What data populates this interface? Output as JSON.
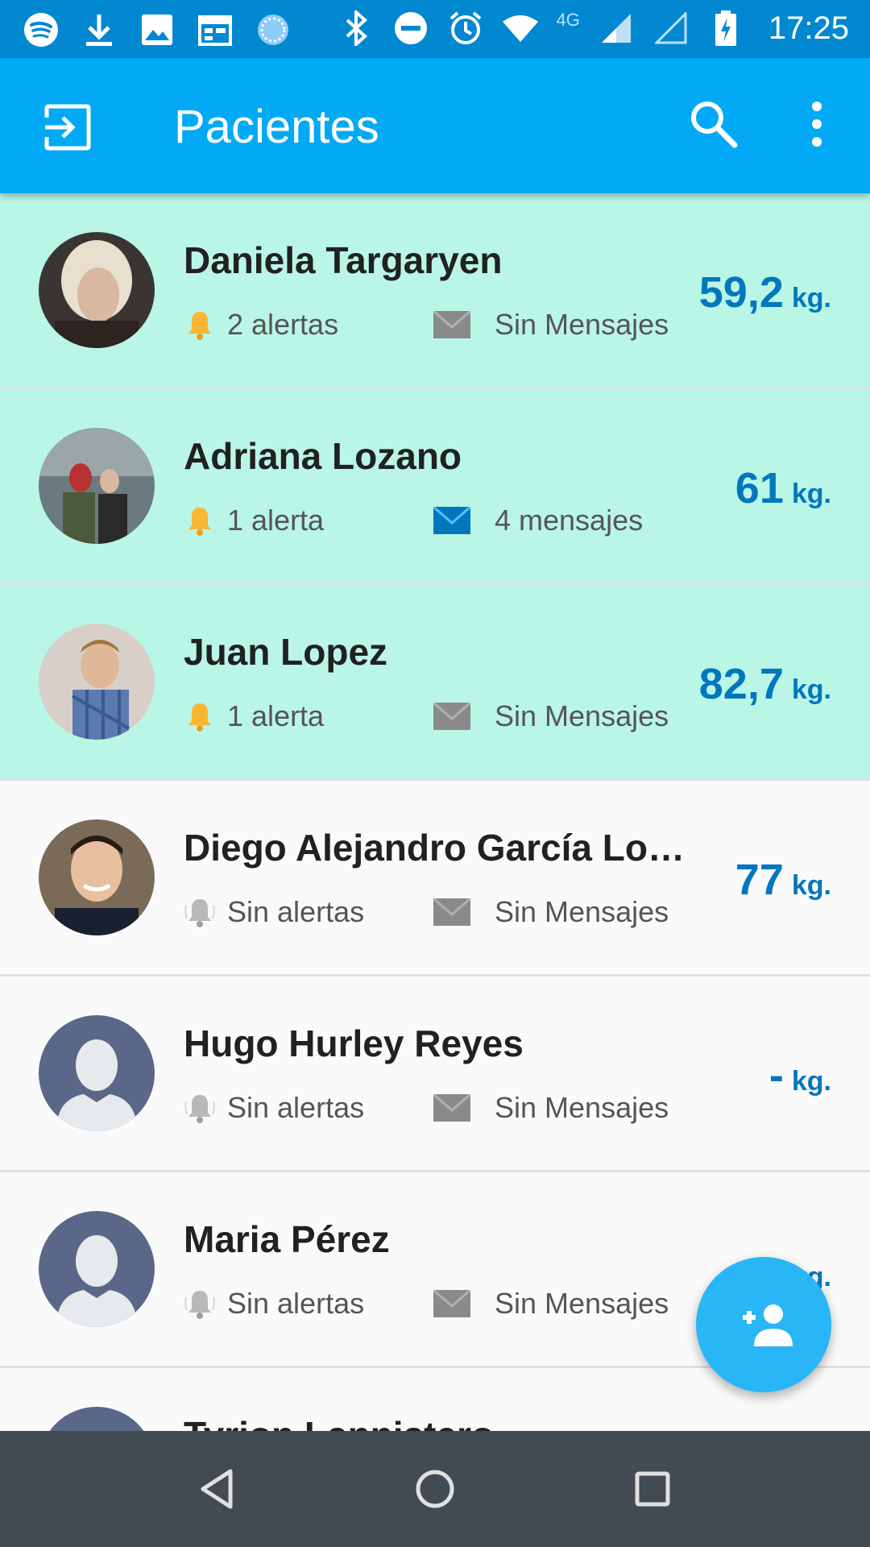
{
  "status_bar": {
    "time": "17:25",
    "network": "4G",
    "left_icons": [
      "spotify-icon",
      "download-icon",
      "image-icon",
      "calendar-icon",
      "sync-icon"
    ],
    "right_icons": [
      "bluetooth-icon",
      "dnd-icon",
      "alarm-icon",
      "wifi-icon",
      "signal-icon",
      "signal-empty-icon",
      "battery-charging-icon"
    ]
  },
  "app_bar": {
    "title": "Pacientes",
    "left_icon": "exit-to-app-icon",
    "actions": [
      "search-icon",
      "more-vert-icon"
    ]
  },
  "colors": {
    "status_bar": "#0288d1",
    "app_bar": "#03a9f4",
    "highlight_row": "#b9f6e6",
    "weight_text": "#0277bd",
    "fab": "#29b6f6",
    "nav_bar": "#424a52"
  },
  "patients": [
    {
      "name": "Daniela Targaryen",
      "alerts": "2 alertas",
      "messages": "Sin Mensajes",
      "weight": "59,2",
      "unit": "kg.",
      "highlighted": true
    },
    {
      "name": "Adriana Lozano",
      "alerts": "1 alerta",
      "messages": "4 mensajes",
      "weight": "61",
      "unit": "kg.",
      "highlighted": true
    },
    {
      "name": "Juan Lopez",
      "alerts": "1 alerta",
      "messages": "Sin Mensajes",
      "weight": "82,7",
      "unit": "kg.",
      "highlighted": true
    },
    {
      "name": "Diego Alejandro García Loz…",
      "alerts": "Sin alertas",
      "messages": "Sin Mensajes",
      "weight": "77",
      "unit": "kg.",
      "highlighted": false
    },
    {
      "name": "Hugo Hurley Reyes",
      "alerts": "Sin alertas",
      "messages": "Sin Mensajes",
      "weight": "-",
      "unit": "kg.",
      "highlighted": false
    },
    {
      "name": "Maria Pérez",
      "alerts": "Sin alertas",
      "messages": "Sin Mensajes",
      "weight": "",
      "unit": "kg.",
      "highlighted": false
    },
    {
      "name": "Tyrion Lannistero",
      "alerts": "",
      "messages": "",
      "weight": "",
      "unit": "",
      "highlighted": false
    }
  ],
  "fab": {
    "icon": "person-add-icon"
  },
  "nav_bar": {
    "buttons": [
      "back-icon",
      "home-icon",
      "recents-icon"
    ]
  }
}
